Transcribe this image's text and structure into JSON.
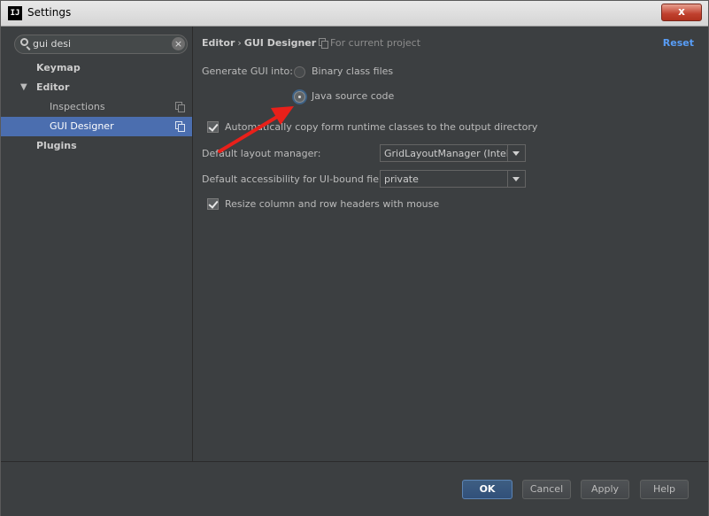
{
  "window": {
    "title": "Settings",
    "app_icon": "IJ",
    "close_label": "x"
  },
  "sidebar": {
    "search_value": "gui desi",
    "items": [
      {
        "label": "Keymap"
      },
      {
        "label": "Editor"
      },
      {
        "label": "Inspections"
      },
      {
        "label": "GUI Designer"
      },
      {
        "label": "Plugins"
      }
    ]
  },
  "header": {
    "breadcrumb_parent": "Editor",
    "breadcrumb_sep": "›",
    "breadcrumb_current": "GUI Designer",
    "scope_label": "For current project",
    "reset_label": "Reset"
  },
  "form": {
    "generate_label": "Generate GUI into:",
    "radio_binary": "Binary class files",
    "radio_java": "Java source code",
    "auto_copy_label": "Automatically copy form runtime classes to the output directory",
    "layout_label": "Default layout manager:",
    "layout_value": "GridLayoutManager (IntelliJ)",
    "accessibility_label": "Default accessibility for UI-bound fields:",
    "accessibility_value": "private",
    "resize_label": "Resize column and row headers with mouse"
  },
  "footer": {
    "ok": "OK",
    "cancel": "Cancel",
    "apply": "Apply",
    "help": "Help"
  },
  "colors": {
    "accent": "#4b6eaf",
    "link": "#589df6",
    "annotation_arrow": "#e8201a"
  }
}
